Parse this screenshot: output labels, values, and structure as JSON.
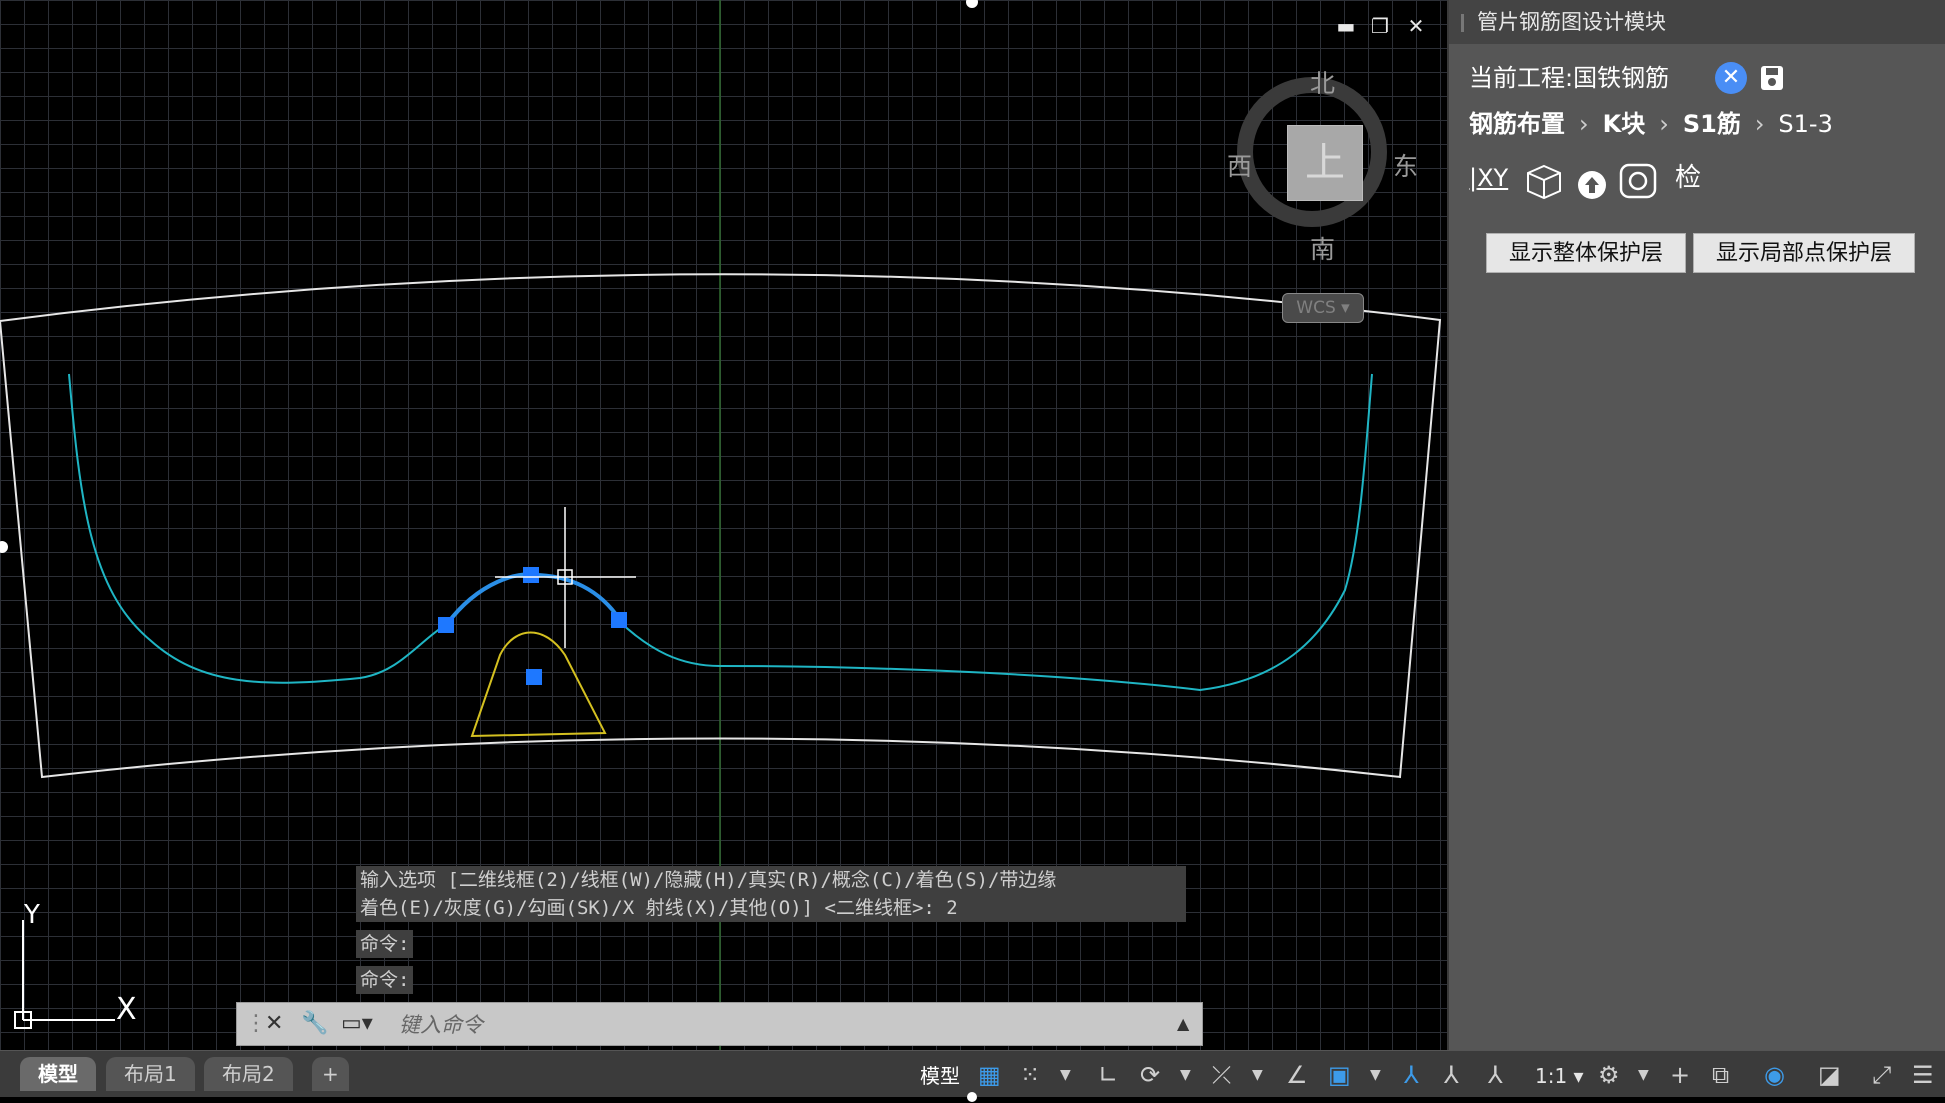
{
  "panel": {
    "title": "管片钢筋图设计模块",
    "project_label": "当前工程:国铁钢筋",
    "breadcrumb": [
      "钢筋布置",
      "K块",
      "S1筋",
      "S1-3"
    ],
    "tool_xy_label": "XY",
    "tool_check_label": "检",
    "btn_show_overall_cover": "显示整体保护层",
    "btn_show_local_cover": "显示局部点保护层"
  },
  "viewcube": {
    "north": "北",
    "south": "南",
    "west": "西",
    "east": "东",
    "top_face": "上",
    "wcs": "WCS"
  },
  "ucs": {
    "y": "Y",
    "x": "X"
  },
  "command": {
    "history": [
      "输入选项 [二维线框(2)/线框(W)/隐藏(H)/真实(R)/概念(C)/着色(S)/带边缘",
      "着色(E)/灰度(G)/勾画(SK)/X 射线(X)/其他(O)] <二维线框>: 2",
      "命令:",
      "命令:"
    ],
    "placeholder": "键入命令"
  },
  "window_controls": {
    "minimize": "▬",
    "restore": "❐",
    "close": "✕"
  },
  "statusbar": {
    "tabs": [
      "模型",
      "布局1",
      "布局2"
    ],
    "add_tab": "+",
    "model_label": "模型",
    "scale": "1:1"
  },
  "colors": {
    "outline": "#e6e6e6",
    "rebar": "#1fb5c4",
    "selected": "#2a8ee6",
    "hole": "#d4c020",
    "grip": "#1e78ff",
    "axis": "#2f6a2f",
    "panel_bg": "#565656"
  }
}
